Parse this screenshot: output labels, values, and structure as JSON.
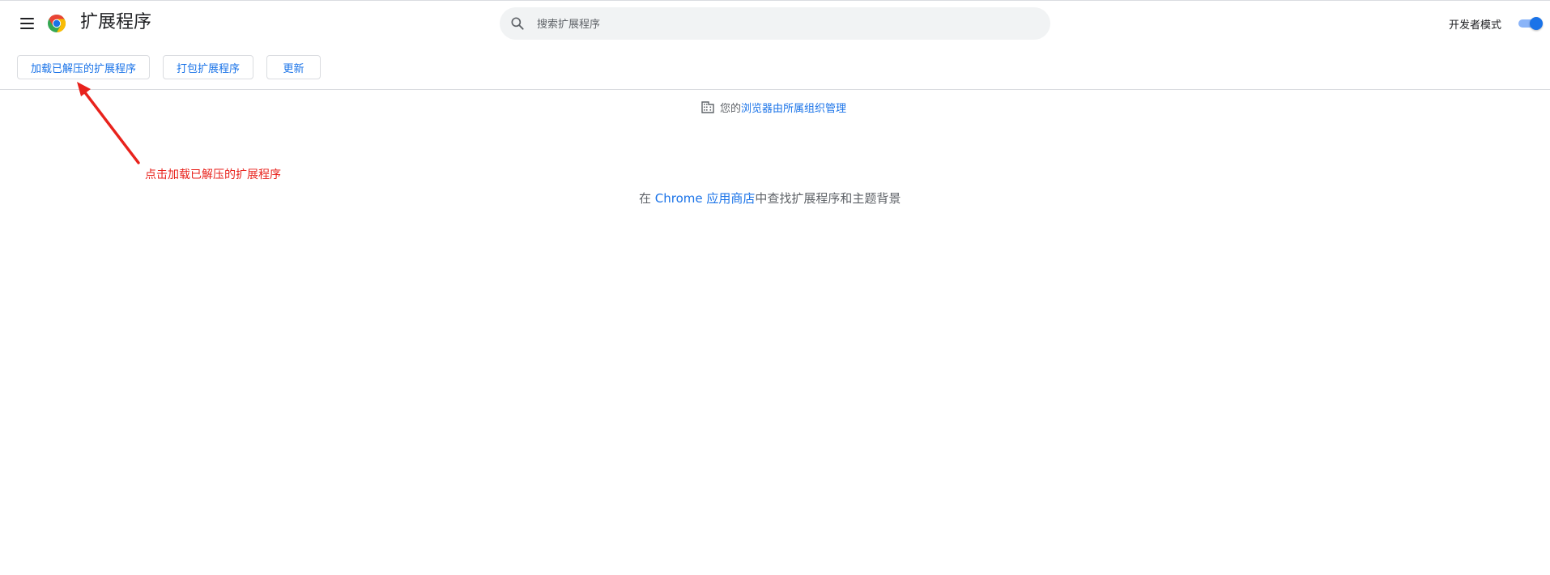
{
  "header": {
    "title": "扩展程序",
    "menu_icon": "hamburger-menu-icon",
    "logo_icon": "chrome-logo-icon"
  },
  "search": {
    "placeholder": "搜索扩展程序",
    "value": "",
    "icon": "search-icon"
  },
  "dev_mode": {
    "label": "开发者模式",
    "enabled": true
  },
  "toolbar": {
    "load_unpacked_label": "加载已解压的扩展程序",
    "pack_label": "打包扩展程序",
    "update_label": "更新"
  },
  "managed_notice": {
    "icon": "building-icon",
    "prefix": "您的",
    "link": "浏览器由所属组织管理"
  },
  "annotation": {
    "text": "点击加载已解压的扩展程序",
    "color": "#e8221c"
  },
  "store_message": {
    "prefix": "在 ",
    "link": "Chrome 应用商店",
    "suffix": "中查找扩展程序和主题背景"
  },
  "colors": {
    "accent": "#1a73e8",
    "annotation": "#e8221c",
    "text_secondary": "#5f6368"
  }
}
